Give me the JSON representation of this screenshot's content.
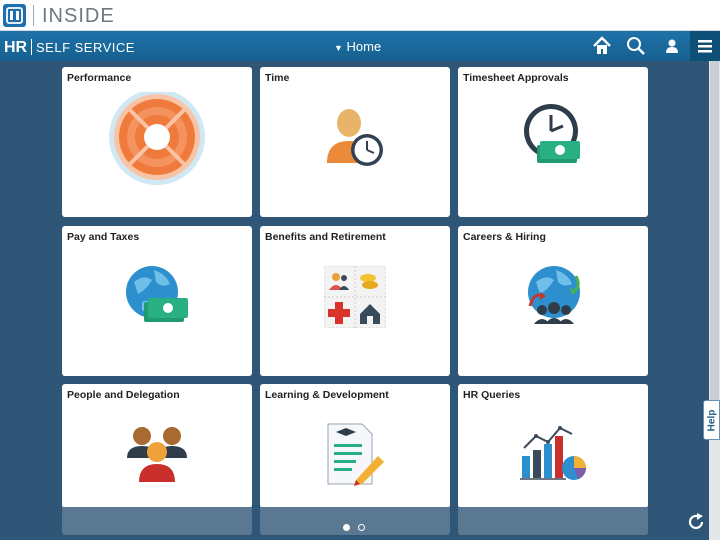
{
  "brand": {
    "name": "INSIDE"
  },
  "header": {
    "hr": "HR",
    "subtitle": "SELF SERVICE",
    "title": "Home"
  },
  "tiles": [
    {
      "title": "Performance",
      "icon": "lifebuoy-target-icon"
    },
    {
      "title": "Time",
      "icon": "person-clock-icon"
    },
    {
      "title": "Timesheet Approvals",
      "icon": "clock-money-icon"
    },
    {
      "title": "Pay and Taxes",
      "icon": "globe-money-icon"
    },
    {
      "title": "Benefits and Retirement",
      "icon": "benefits-grid-icon"
    },
    {
      "title": "Careers & Hiring",
      "icon": "globe-people-icon"
    },
    {
      "title": "People and Delegation",
      "icon": "people-group-icon"
    },
    {
      "title": "Learning & Development",
      "icon": "document-pencil-icon"
    },
    {
      "title": "HR Queries",
      "icon": "bar-pie-chart-icon"
    }
  ],
  "help": {
    "label": "Help"
  },
  "pagination": {
    "pages": 2,
    "current": 1
  },
  "colors": {
    "header": "#1f72aa",
    "background": "#2f5577",
    "accent_orange": "#f07a3c"
  }
}
